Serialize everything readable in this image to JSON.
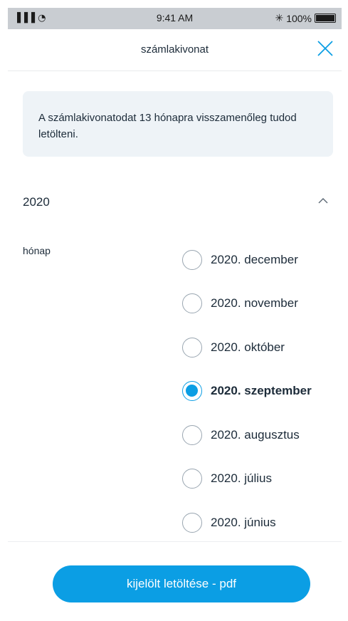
{
  "status_bar": {
    "signal": "▐▐▐ ◔",
    "time": "9:41 AM",
    "bluetooth": "✳",
    "battery": "100%"
  },
  "header": {
    "title": "számlakivonat",
    "close_icon": "close-icon"
  },
  "info": {
    "text": "A számlakivonatodat 13 hónapra visszamenőleg tudod letölteni."
  },
  "year_section": {
    "year": "2020",
    "expanded": true,
    "month_label": "hónap",
    "months": [
      {
        "label": "2020. december",
        "selected": false
      },
      {
        "label": "2020. november",
        "selected": false
      },
      {
        "label": "2020. október",
        "selected": false
      },
      {
        "label": "2020. szeptember",
        "selected": true
      },
      {
        "label": "2020. augusztus",
        "selected": false
      },
      {
        "label": "2020. július",
        "selected": false
      },
      {
        "label": "2020. június",
        "selected": false
      }
    ]
  },
  "footer": {
    "download_label": "kijelölt letöltése - pdf"
  },
  "colors": {
    "accent": "#0b9ee4",
    "info_bg": "#eef3f7",
    "text": "#1c2b39"
  }
}
